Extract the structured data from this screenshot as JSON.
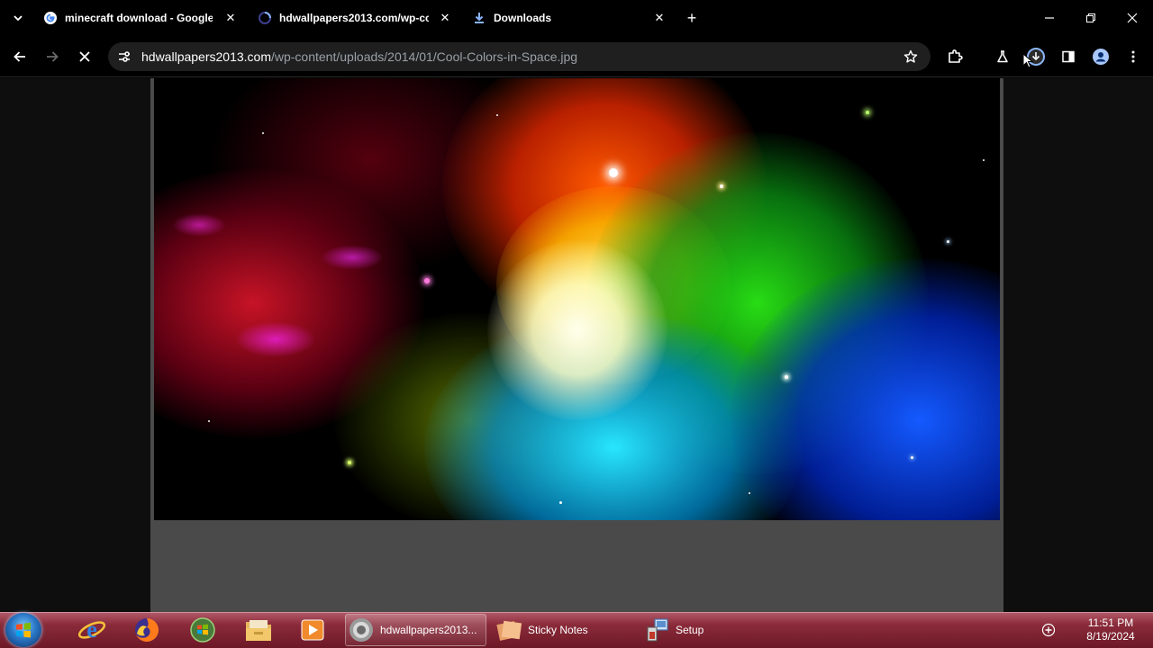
{
  "tabs": [
    {
      "title": "minecraft download - Google",
      "icon": "google-icon"
    },
    {
      "title": "hdwallpapers2013.com/wp-co",
      "icon": "loading-icon"
    },
    {
      "title": "Downloads",
      "icon": "download-icon"
    }
  ],
  "omnibox": {
    "host": "hdwallpapers2013.com",
    "path": "/wp-content/uploads/2014/01/Cool-Colors-in-Space.jpg"
  },
  "taskbar": {
    "tasks": [
      {
        "label": "hdwallpapers2013...",
        "icon": "chrome-icon"
      },
      {
        "label": "Sticky Notes",
        "icon": "sticky-notes-icon"
      },
      {
        "label": "Setup",
        "icon": "setup-icon"
      }
    ],
    "pinned": [
      "internet-explorer-icon",
      "firefox-icon",
      "media-center-icon",
      "file-explorer-icon",
      "media-player-icon"
    ]
  },
  "clock": {
    "time": "11:51 PM",
    "date": "8/19/2024"
  },
  "colors": {
    "accent": "#8a2b3a",
    "omnibox_bg": "#1f1f1f",
    "background": "#000000"
  }
}
